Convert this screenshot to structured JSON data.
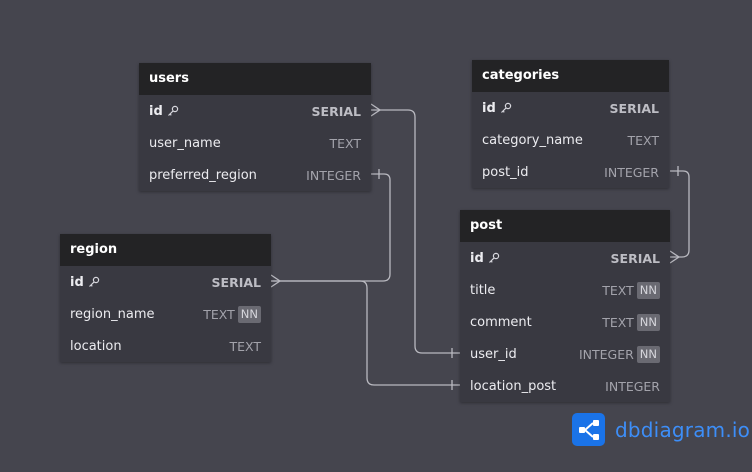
{
  "tables": {
    "users": {
      "title": "users",
      "rows": [
        {
          "name": "id",
          "type": "SERIAL",
          "pk": true
        },
        {
          "name": "user_name",
          "type": "TEXT"
        },
        {
          "name": "preferred_region",
          "type": "INTEGER"
        }
      ]
    },
    "categories": {
      "title": "categories",
      "rows": [
        {
          "name": "id",
          "type": "SERIAL",
          "pk": true
        },
        {
          "name": "category_name",
          "type": "TEXT"
        },
        {
          "name": "post_id",
          "type": "INTEGER"
        }
      ]
    },
    "region": {
      "title": "region",
      "rows": [
        {
          "name": "id",
          "type": "SERIAL",
          "pk": true
        },
        {
          "name": "region_name",
          "type": "TEXT",
          "nn": "NN"
        },
        {
          "name": "location",
          "type": "TEXT"
        }
      ]
    },
    "post": {
      "title": "post",
      "rows": [
        {
          "name": "id",
          "type": "SERIAL",
          "pk": true
        },
        {
          "name": "title",
          "type": "TEXT",
          "nn": "NN"
        },
        {
          "name": "comment",
          "type": "TEXT",
          "nn": "NN"
        },
        {
          "name": "user_id",
          "type": "INTEGER",
          "nn": "NN"
        },
        {
          "name": "location_post",
          "type": "INTEGER"
        }
      ]
    }
  },
  "brand": {
    "text_main": "dbdiagram",
    "text_suffix": ".io",
    "color": "#3d8ef8"
  },
  "colors": {
    "background": "#45454e",
    "header": "#232325",
    "body": "#393941",
    "connector": "#b9b9c0"
  }
}
